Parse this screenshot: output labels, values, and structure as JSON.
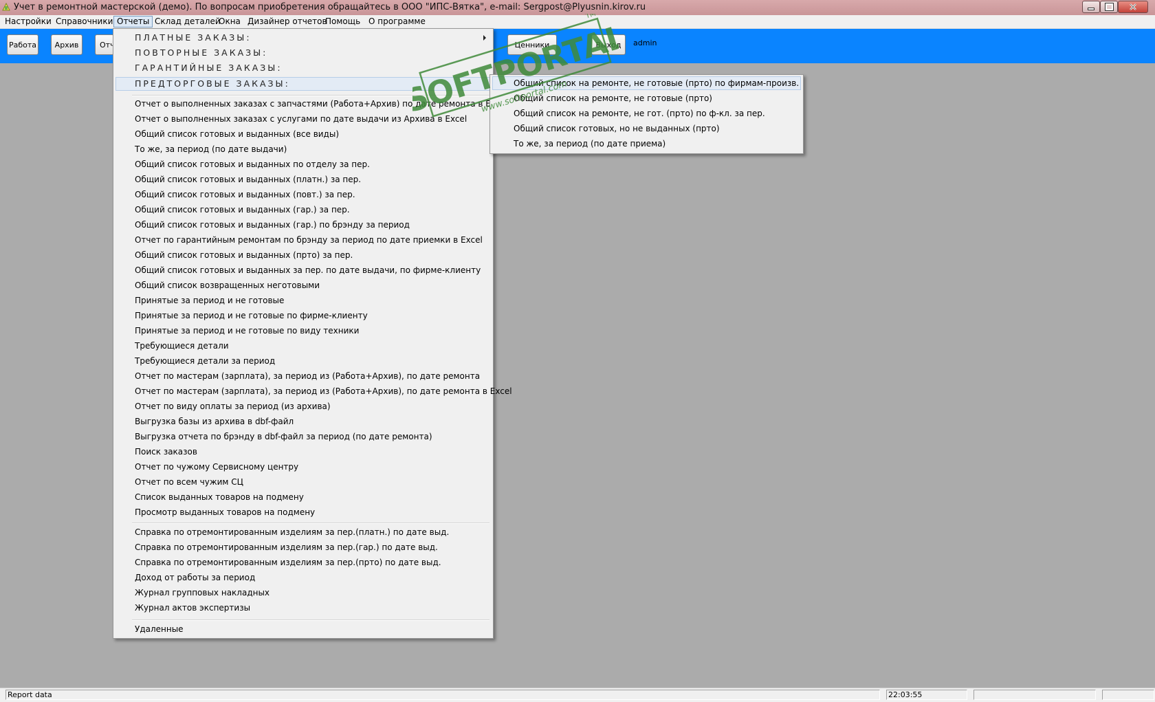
{
  "window": {
    "title": "Учет в ремонтной мастерской (демо). По вопросам приобретения обращайтесь в ООО \"ИПС-Вятка\", e-mail: Sergpost@Plyusnin.kirov.ru"
  },
  "menubar": [
    {
      "label": "Настройки"
    },
    {
      "label": "Справочники"
    },
    {
      "label": "Отчеты"
    },
    {
      "label": "Склад деталей"
    },
    {
      "label": "Окна"
    },
    {
      "label": "Дизайнер отчетов"
    },
    {
      "label": "Помощь"
    },
    {
      "label": "О программе"
    }
  ],
  "toolbar": {
    "work_label": "Работа",
    "archive_label": "Архив",
    "reports_label": "Отч",
    "prices_label": "Ценники",
    "exit_label": "Выход",
    "user": "admin"
  },
  "reports_menu": {
    "headers": [
      "ПЛАТНЫЕ ЗАКАЗЫ:",
      "ПОВТОРНЫЕ ЗАКАЗЫ:",
      "ГАРАНТИЙНЫЕ ЗАКАЗЫ:",
      "ПРЕДТОРГОВЫЕ ЗАКАЗЫ:"
    ],
    "group1": [
      "Отчет о выполненных заказах с запчастями (Работа+Архив) по дате ремонта в Excel",
      "Отчет о выполненных заказах с услугами по дате выдачи из Архива в Excel",
      "Общий список готовых и выданных (все виды)",
      "То же, за период (по дате выдачи)",
      "Общий список готовых и выданных по отделу за пер.",
      "Общий список готовых и выданных (платн.) за пер.",
      "Общий список готовых и выданных (повт.) за пер.",
      "Общий список готовых и выданных (гар.) за пер.",
      "Общий список готовых и выданных (гар.) по брэнду за период",
      "Отчет по гарантийным ремонтам по брэнду за период по дате приемки в Excel",
      "Общий список готовых и выданных (прто) за пер.",
      "Общий список готовых и выданных за пер. по дате выдачи, по фирме-клиенту",
      "Общий список возвращенных неготовыми",
      "Принятые  за период и не готовые",
      "Принятые  за период и не готовые по фирме-клиенту",
      "Принятые  за период и не готовые по виду техники",
      "Требующиеся детали",
      "Требующиеся детали за период",
      "Отчет по мастерам (зарплата), за период из (Работа+Архив), по дате ремонта",
      "Отчет по мастерам (зарплата), за период из (Работа+Архив), по дате ремонта в Excel",
      "Отчет по виду оплаты за период (из архива)",
      "Выгрузка базы из архива в dbf-файл",
      "Выгрузка отчета по брэнду в dbf-файл за период (по дате ремонта)",
      "Поиск заказов",
      "Отчет по чужому Сервисному центру",
      "Отчет по всем чужим СЦ",
      "Список выданных товаров на подмену",
      "Просмотр выданных товаров на подмену"
    ],
    "group2": [
      "Справка по отремонтированным изделиям за пер.(платн.) по дате выд.",
      "Справка по отремонтированным изделиям за пер.(гар.) по дате выд.",
      "Справка по отремонтированным изделиям за пер.(прто) по дате выд.",
      "Доход от работы за период",
      "Журнал групповых накладных",
      "Журнал актов экспертизы"
    ],
    "group3": [
      "Удаленные"
    ]
  },
  "submenu": [
    "Общий список на ремонте, не готовые (прто) по фирмам-произв.",
    "Общий список на ремонте, не готовые (прто)",
    "Общий список на ремонте, не гот. (прто) по ф-кл. за пер.",
    "Общий список готовых, но не выданных (прто)",
    "То же, за период (по дате приема)"
  ],
  "watermark": {
    "brand": "SOFTPORTAL",
    "url": "www.softportal.com",
    "tm": "TM",
    "color": "#3f8a3a"
  },
  "statusbar": {
    "left_text": "Report data",
    "time": "22:03:55"
  },
  "colors": {
    "toolbar_bg": "#0a84ff",
    "titlebar_bg": "#cf9fa2",
    "desktop_bg": "#ababab",
    "menu_bg": "#f0f0f0",
    "highlight": "#e3ebf5"
  }
}
